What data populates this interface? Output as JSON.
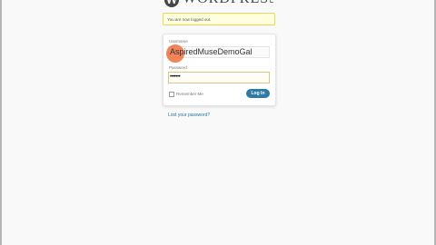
{
  "logo": {
    "wordmark": "WORDPRESS",
    "mark": "W"
  },
  "message": "You are now logged out.",
  "login": {
    "username_label": "Username",
    "username_value": "AspiredMuseDemoGal",
    "password_label": "Password",
    "password_mask": "•••••••",
    "remember_label": "Remember Me",
    "remember_checked": false,
    "submit_label": "Log In"
  },
  "lost_password": "Lost your password?",
  "colors": {
    "button": "#2e7aa3",
    "message_bg": "#ffffe0",
    "link": "#21759b",
    "cursor": "#ef6e3c"
  }
}
